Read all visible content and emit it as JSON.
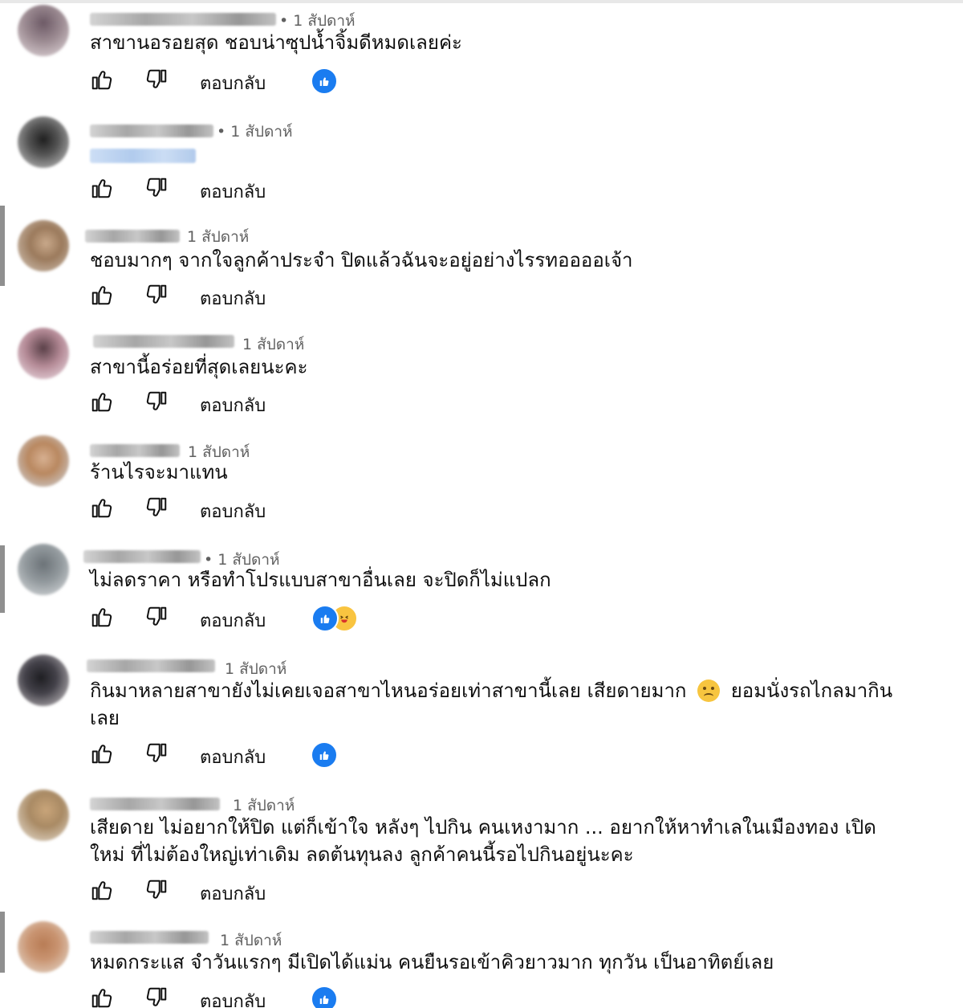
{
  "ui": {
    "reply_label": "ตอบกลับ",
    "like_icon": "thumb-up-outline",
    "dislike_icon": "thumb-down-outline",
    "accent_color": "#1a7cf0"
  },
  "comments": [
    {
      "time": "• 1 สัปดาห์",
      "text": "สาขานอรอยสุด ชอบน่าซุปน้ำจิ้มดีหมดเลยค่ะ",
      "reaction": "like"
    },
    {
      "time": "• 1 สัปดาห์",
      "text": "",
      "reaction": ""
    },
    {
      "time": "1 สัปดาห์",
      "text": "ชอบมากๆ จากใจลูกค้าประจำ ปิดแล้วฉันจะอยู่อย่างไรรทออออเจ้า",
      "reaction": ""
    },
    {
      "time": "1 สัปดาห์",
      "text": "สาขานี้อร่อยที่สุดเลยนะคะ",
      "reaction": ""
    },
    {
      "time": "1 สัปดาห์",
      "text": "ร้านไรจะมาแทน",
      "reaction": ""
    },
    {
      "time": "• 1 สัปดาห์",
      "text": "ไม่ลดราคา หรือทำโปรแบบสาขาอื่นเลย จะปิดก็ไม่แปลก",
      "reaction": "like+haha"
    },
    {
      "time": "1 สัปดาห์",
      "text_a": "กินมาหลายสาขายังไม่เคยเจอสาขาไหนอร่อยเท่าสาขานี้เลย เสียดายมาก",
      "text_b": "ยอมนั่งรถไกลมากินเลย",
      "reaction": "like"
    },
    {
      "time": "1 สัปดาห์",
      "text": "เสียดาย ไม่อยากให้ปิด แต่ก็เข้าใจ หลังๆ ไปกิน คนเหงามาก ... อยากให้หาทำเลในเมืองทอง เปิดใหม่ ที่ไม่ต้องใหญ่เท่าเดิม ลดต้นทุนลง ลูกค้าคนนี้รอไปกินอยู่นะคะ",
      "reaction": ""
    },
    {
      "time": "1 สัปดาห์",
      "text": "หมดกระแส จำวันแรกๆ มีเปิดได้แม่น คนยืนรอเข้าคิวยาวมาก ทุกวัน เป็นอาทิตย์เลย",
      "reaction": "like"
    }
  ]
}
